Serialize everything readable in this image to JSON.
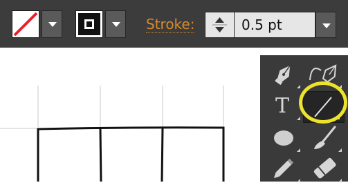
{
  "control_bar": {
    "fill_swatch": {
      "icon": "no-fill-slash-icon",
      "slash_color": "#e8202a"
    },
    "stroke_swatch": {
      "icon": "stroke-square-icon"
    },
    "stroke": {
      "label": "Stroke:",
      "label_color": "#d98a2b",
      "weight_value": "0.5 pt"
    }
  },
  "tools_panel": {
    "tools": [
      {
        "name": "pen-tool",
        "icon": "pen-icon"
      },
      {
        "name": "curvature-tool",
        "icon": "curvature-pen-icon"
      },
      {
        "name": "type-tool",
        "icon": "type-t-icon",
        "glyph": "T"
      },
      {
        "name": "line-segment-tool",
        "icon": "line-segment-icon",
        "selected": true
      },
      {
        "name": "ellipse-tool",
        "icon": "ellipse-icon"
      },
      {
        "name": "paintbrush-tool",
        "icon": "paintbrush-icon"
      },
      {
        "name": "pencil-tool",
        "icon": "pencil-icon"
      },
      {
        "name": "eraser-tool",
        "icon": "eraser-icon"
      }
    ],
    "highlight_color": "#ece32a"
  }
}
